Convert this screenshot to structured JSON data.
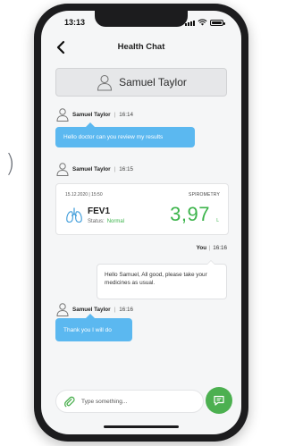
{
  "background": {
    "paren": ")"
  },
  "status_bar": {
    "time": "13:13"
  },
  "header": {
    "title": "Health Chat"
  },
  "contact": {
    "name": "Samuel Taylor"
  },
  "messages": [
    {
      "sender": "Samuel Taylor",
      "time": "16:14",
      "text": "Hello doctor can you review my results"
    },
    {
      "sender": "Samuel Taylor",
      "time": "16:15"
    },
    {
      "sender": "You",
      "time": "16:16",
      "text": "Hello Samuel, All good, please take your medicines as usual."
    },
    {
      "sender": "Samuel Taylor",
      "time": "16:16",
      "text": "Thank you I will do"
    }
  ],
  "spirometry": {
    "date": "15.12.2020 | 15:50",
    "type": "SPIROMETRY",
    "metric": "FEV1",
    "status_label": "Status:",
    "status_value": "Normal",
    "value": "3,97",
    "unit": "L"
  },
  "composer": {
    "placeholder": "Type something..."
  },
  "colors": {
    "accent_green": "#4cb050",
    "bubble_blue": "#5bb8f0",
    "normal_green": "#3cb44b"
  }
}
